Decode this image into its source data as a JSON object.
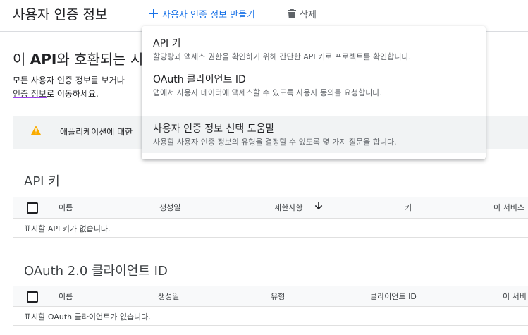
{
  "header": {
    "title": "사용자 인증 정보",
    "create_label": "사용자 인증 정보 만들기",
    "delete_label": "삭제"
  },
  "intro": {
    "api_prefix": "이 ",
    "api_bold": "API",
    "api_suffix": "와 호환되는 시",
    "desc_line1": "모든 사용자 인증 정보를 보거나",
    "desc_link": "인증 정보",
    "desc_line2_suffix": "로 이동하세요."
  },
  "warning": {
    "text": "애플리케이션에 대한"
  },
  "menu": {
    "items": [
      {
        "title": "API 키",
        "desc": "할당량과 액세스 권한을 확인하기 위해 간단한 API 키로 프로젝트를 확인합니다."
      },
      {
        "title": "OAuth 클라이언트 ID",
        "desc": "앱에서 사용자 데이터에 액세스할 수 있도록 사용자 동의를 요청합니다."
      },
      {
        "title": "사용자 인증 정보 선택 도움말",
        "desc": "사용할 사용자 인증 정보의 유형을 결정할 수 있도록 몇 가지 질문을 합니다."
      }
    ]
  },
  "api_keys": {
    "title": "API 키",
    "columns": [
      "이름",
      "생성일",
      "제한사항",
      "키",
      "이 서비스"
    ],
    "empty": "표시할 API 키가 없습니다."
  },
  "oauth": {
    "title": "OAuth 2.0 클라이언트 ID",
    "columns": [
      "이름",
      "생성일",
      "유형",
      "클라이언트 ID",
      "이 서비"
    ],
    "empty": "표시할 OAuth 클라이언트가 없습니다."
  },
  "colors": {
    "accent": "#1a73e8",
    "warning": "#f9ab00"
  }
}
